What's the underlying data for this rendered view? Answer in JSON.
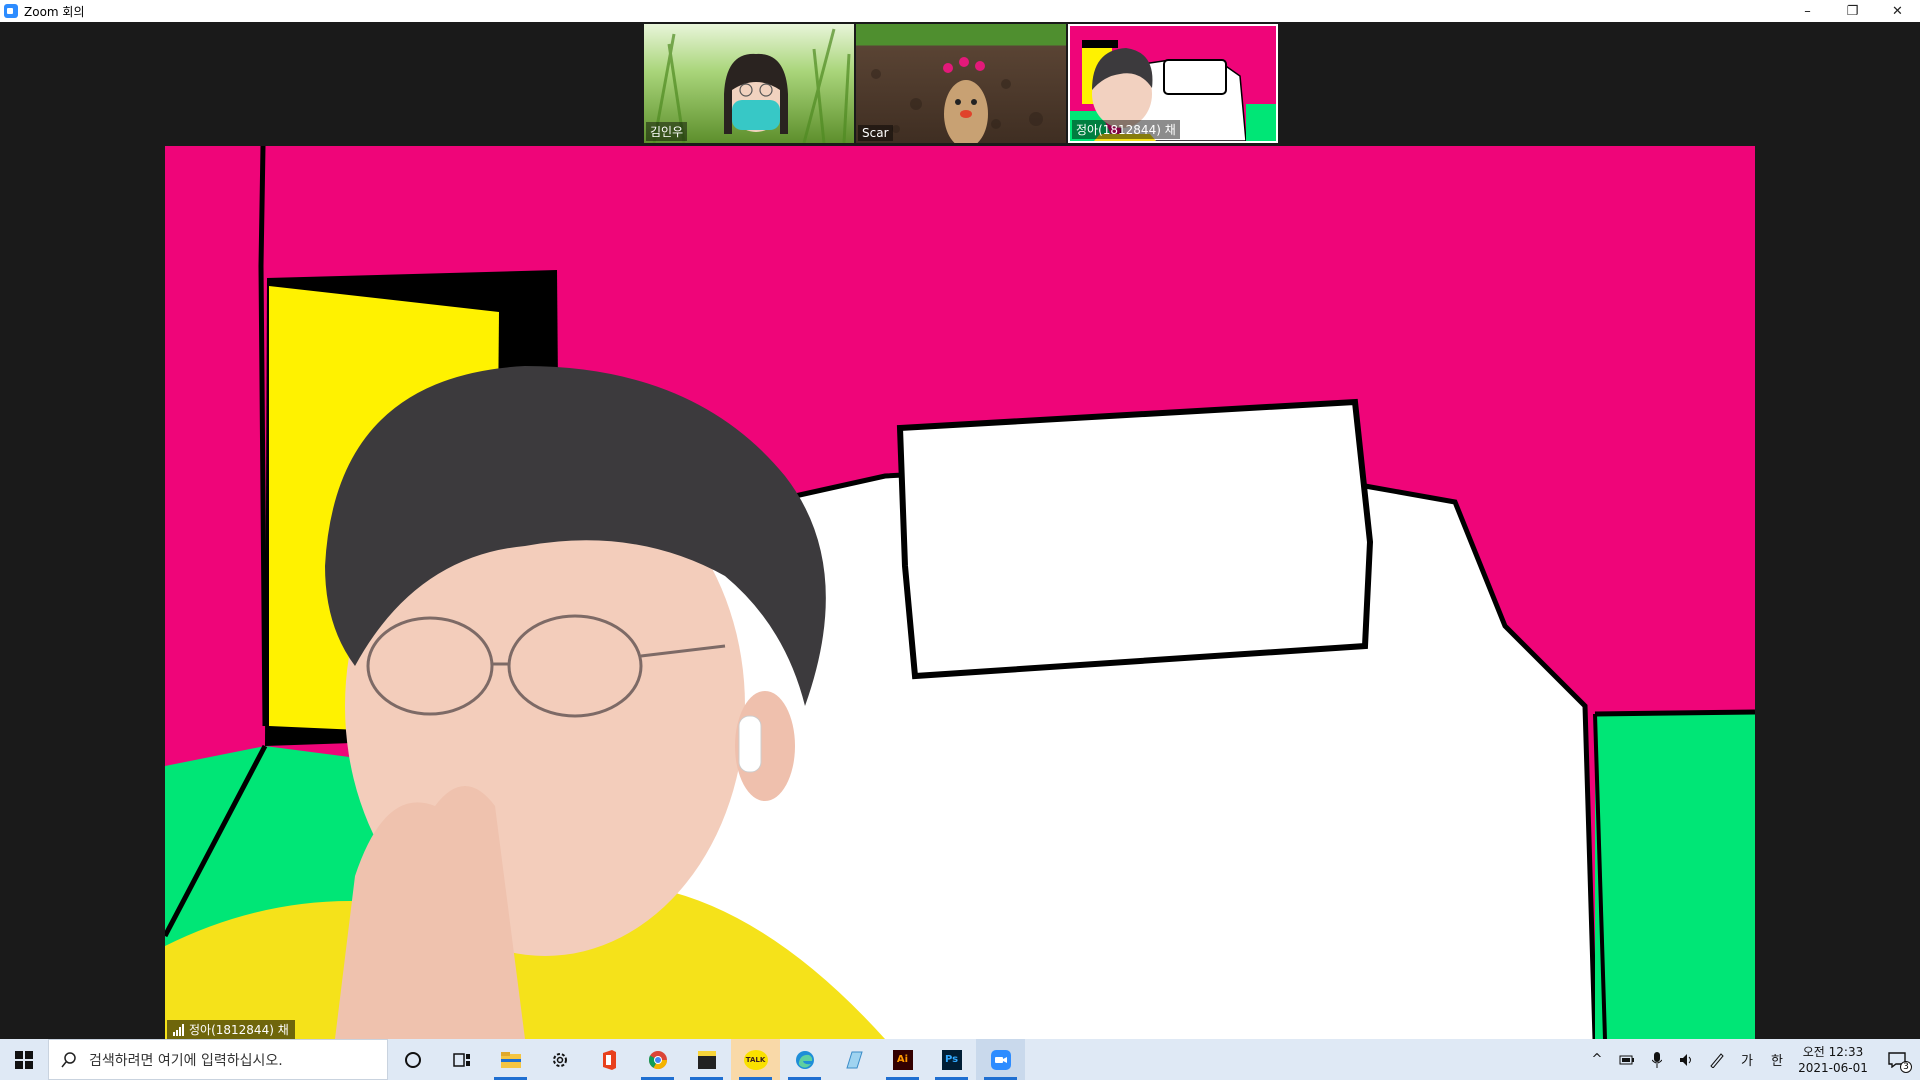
{
  "window": {
    "title": "Zoom 회의",
    "minimize_label": "–",
    "restore_label": "❐",
    "close_label": "✕"
  },
  "thumbnails": [
    {
      "name": "김인우"
    },
    {
      "name": "Scar"
    },
    {
      "name": "정아(1812844) 채"
    }
  ],
  "main_video": {
    "speaker_label": "정아(1812844) 채",
    "background_colors": {
      "wall": "#ef0579",
      "door": "#fff200",
      "floor": "#00e676",
      "bed": "#ffffff",
      "shirt": "#f5e21a"
    }
  },
  "taskbar": {
    "search_placeholder": "검색하려면 여기에 입력하십시오.",
    "apps": [
      "cortana-icon",
      "task-view-icon",
      "file-explorer-icon",
      "settings-icon",
      "office-icon",
      "chrome-icon",
      "sticky-notes-icon",
      "kakaotalk-icon",
      "edge-icon",
      "notepad-icon",
      "illustrator-icon",
      "photoshop-icon",
      "zoom-icon"
    ],
    "kakaotalk_label": "TALK",
    "illustrator_label": "Ai",
    "photoshop_label": "Ps",
    "tray": {
      "chevron": "^",
      "ime_mode": "가",
      "ime_lang": "한"
    },
    "clock": {
      "time": "오전 12:33",
      "date": "2021-06-01"
    },
    "notification_count": "3"
  }
}
